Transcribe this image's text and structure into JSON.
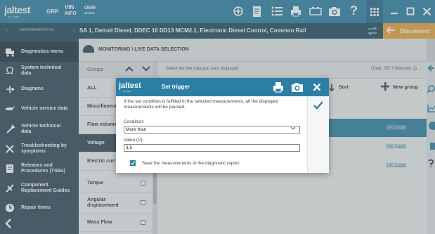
{
  "topbar": {
    "logo": "jaltest",
    "logo_sub": "by Cojali",
    "grp": "GRP",
    "vin_line1": "VIN",
    "vin_line2": "INFO",
    "oem_line1": "OEM",
    "oem_line2": "SPIDER",
    "icons": [
      "hub-icon",
      "document-icon",
      "list-icon",
      "printer-icon",
      "battery-icon",
      "camera-icon",
      "help-icon",
      "grid-icon",
      "minimize-icon",
      "maximize-icon",
      "close-icon"
    ],
    "help_glyph": "?"
  },
  "subbar": {
    "crumb_small": "MANTENIMIENTO-01",
    "crumb_main": "SA 1, Detroit Diesel, DDEC 16 DD13 MCM2.1, Electronic Diesel Control, Common Rail",
    "disconnect": "Disconnect"
  },
  "sidebar": {
    "items": [
      {
        "label": "Diagnostics menu",
        "icon": "vehicle-icon"
      },
      {
        "label": "System technical data",
        "icon": "omega-icon"
      },
      {
        "label": "Diagrams",
        "icon": "diagram-icon"
      },
      {
        "label": "Vehicle service data",
        "icon": "oil-can-icon"
      },
      {
        "label": "Vehicle technical data",
        "icon": "wrench-icon"
      },
      {
        "label": "Troubleshooting by symptoms",
        "icon": "tools-icon"
      },
      {
        "label": "Releases and Procedures (TSBs)",
        "icon": "document-icon"
      },
      {
        "label": "Component Replacement Guides",
        "icon": "repair-icon"
      },
      {
        "label": "Repair times",
        "icon": "clock-icon"
      }
    ],
    "back_icon": "back-icon"
  },
  "main": {
    "title": "MONITORING \\ LIVE DATA SELECTION",
    "groups_header": "Groups",
    "groups": [
      "ALL",
      "Miscellaneous",
      "Flow volume",
      "Voltage",
      "Electric current",
      "Torque",
      "Angular displacement",
      "Mass Flow"
    ],
    "instruction": "Select the live data you want displayed",
    "total": "(Total: 257 / Selected: 1)",
    "sort": "Sort",
    "new_group": "New group",
    "add_trigger": "Add trigger"
  },
  "dialog": {
    "logo": "jaltest",
    "logo_sub": "by Cojali",
    "title": "Set trigger",
    "info": "If the set condition is fulfilled in the selected measurements, all the displayed measurements will be paused.",
    "condition_label": "Condition:",
    "condition_value": "More than",
    "value_label": "Value (V):",
    "value": "3,5",
    "save_label": "Save the measurements in the diagnostic report.",
    "save_checked": true
  },
  "colors": {
    "primary": "#2c7fa3",
    "sidebar": "#2e4858",
    "accent": "#e8a33b"
  }
}
